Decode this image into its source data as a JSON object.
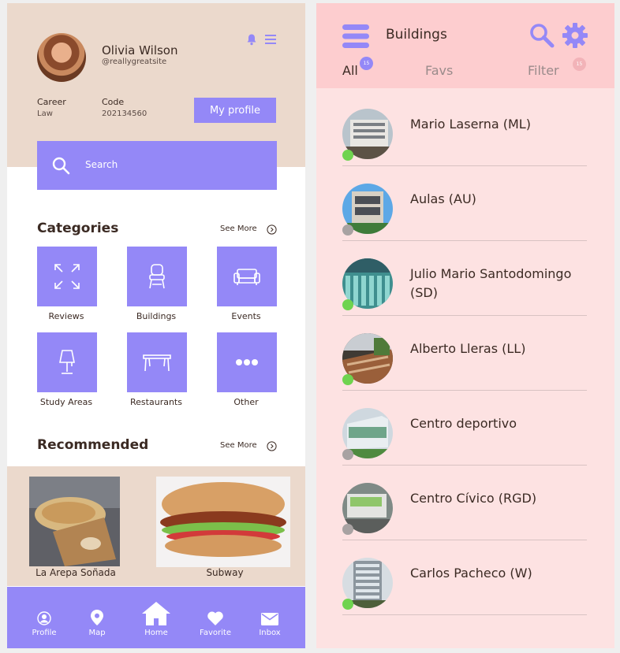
{
  "left": {
    "profile": {
      "name": "Olivia Wilson",
      "handle": "@reallygreatsite"
    },
    "career": {
      "label": "Career",
      "value": "Law"
    },
    "code": {
      "label": "Code",
      "value": "202134560"
    },
    "my_profile_button": "My profile",
    "search": {
      "placeholder": "Search"
    },
    "categories": {
      "title": "Categories",
      "see_more": "See More",
      "items": [
        {
          "label": "Reviews",
          "icon": "expand-arrows-icon"
        },
        {
          "label": "Buildings",
          "icon": "chair-icon"
        },
        {
          "label": "Events",
          "icon": "sofa-icon"
        },
        {
          "label": "Study Areas",
          "icon": "lamp-icon"
        },
        {
          "label": "Restaurants",
          "icon": "table-icon"
        },
        {
          "label": "Other",
          "icon": "more-dots-icon"
        }
      ]
    },
    "recommended": {
      "title": "Recommended",
      "see_more": "See More",
      "items": [
        {
          "label": "La Arepa Soñada"
        },
        {
          "label": "Subway"
        }
      ]
    },
    "nav": [
      {
        "label": "Profile",
        "icon": "profile-icon"
      },
      {
        "label": "Map",
        "icon": "map-pin-icon"
      },
      {
        "label": "Home",
        "icon": "home-icon"
      },
      {
        "label": "Favorite",
        "icon": "heart-icon"
      },
      {
        "label": "Inbox",
        "icon": "mail-icon"
      }
    ],
    "colors": {
      "accent": "#9488f7",
      "band": "#ebd9cc",
      "text": "#3b2a23"
    }
  },
  "right": {
    "title": "Buildings",
    "tabs": [
      {
        "label": "All",
        "badge": "15"
      },
      {
        "label": "Favs"
      },
      {
        "label": "Filter",
        "badge": "15"
      }
    ],
    "buildings": [
      {
        "name": "Mario Laserna (ML)",
        "status": "online"
      },
      {
        "name": "Aulas (AU)",
        "status": "offline"
      },
      {
        "name": "Julio Mario Santodomingo (SD)",
        "status": "online"
      },
      {
        "name": "Alberto Lleras (LL)",
        "status": "online"
      },
      {
        "name": "Centro deportivo",
        "status": "offline"
      },
      {
        "name": "Centro Cívico (RGD)",
        "status": "offline"
      },
      {
        "name": "Carlos Pacheco (W)",
        "status": "online"
      }
    ],
    "colors": {
      "header": "#fdcdcf",
      "background": "#fde2e2",
      "online": "#6fd34f",
      "offline": "#a8a2a2",
      "icon": "#9488f7"
    }
  }
}
